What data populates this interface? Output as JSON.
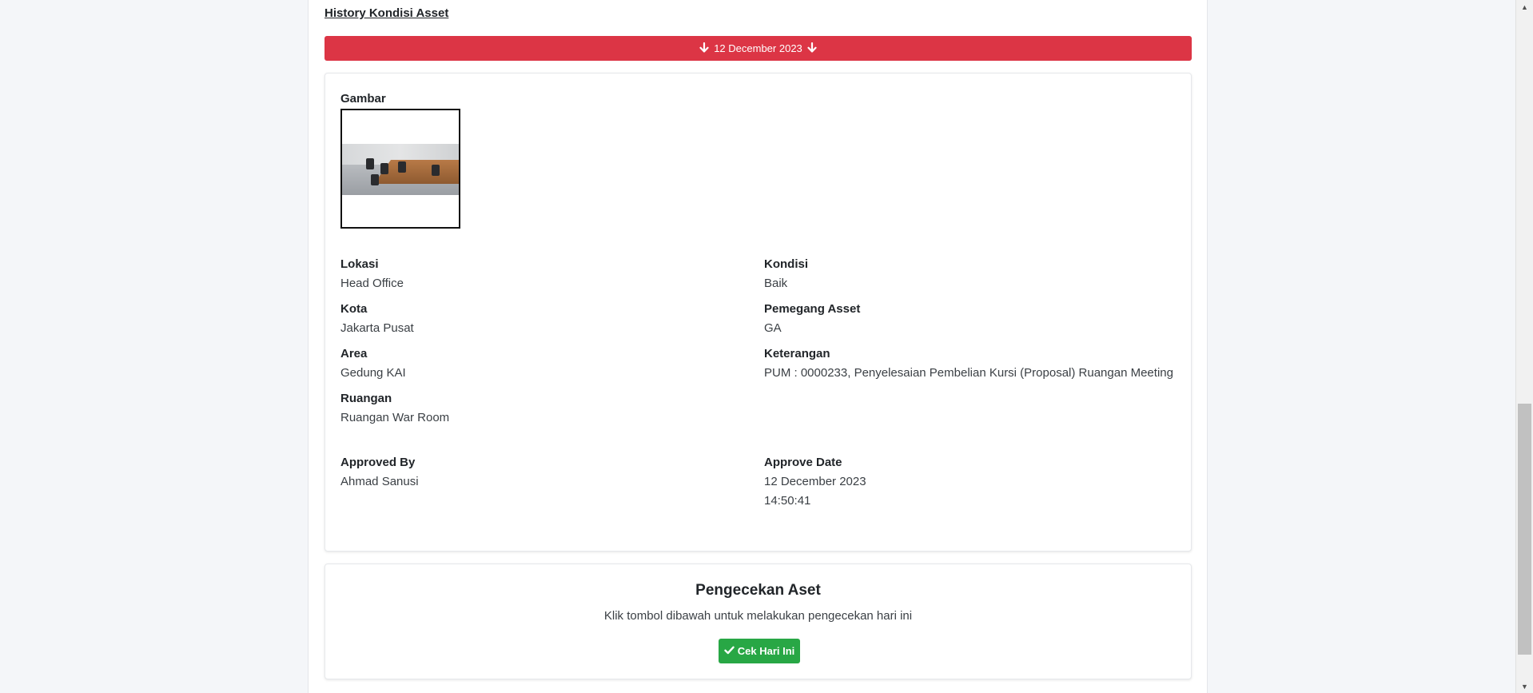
{
  "history": {
    "title": "History Kondisi Asset",
    "date_label": "12 December 2023"
  },
  "detail": {
    "image_label": "Gambar",
    "image_alt": "Foto ruangan meeting dengan meja kayu dan kursi",
    "fields_left": [
      {
        "label": "Lokasi",
        "value": "Head Office"
      },
      {
        "label": "Kota",
        "value": "Jakarta Pusat"
      },
      {
        "label": "Area",
        "value": "Gedung KAI"
      },
      {
        "label": "Ruangan",
        "value": "Ruangan War Room"
      }
    ],
    "fields_right": [
      {
        "label": "Kondisi",
        "value": "Baik"
      },
      {
        "label": "Pemegang Asset",
        "value": "GA"
      },
      {
        "label": "Keterangan",
        "value": "PUM : 0000233, Penyelesaian Pembelian Kursi (Proposal) Ruangan Meeting"
      }
    ],
    "approved_by": {
      "label": "Approved By",
      "value": "Ahmad Sanusi"
    },
    "approve_date": {
      "label": "Approve Date",
      "date": "12 December 2023",
      "time": "14:50:41"
    }
  },
  "check": {
    "title": "Pengecekan Aset",
    "description": "Klik tombol dibawah untuk melakukan pengecekan hari ini",
    "button_label": "Cek Hari Ini"
  },
  "colors": {
    "date_bar": "#dc3545",
    "check_button": "#28a745"
  },
  "icons": {
    "date_bar_left": "arrow-down-icon",
    "date_bar_right": "arrow-down-icon",
    "check_button": "check-icon"
  }
}
